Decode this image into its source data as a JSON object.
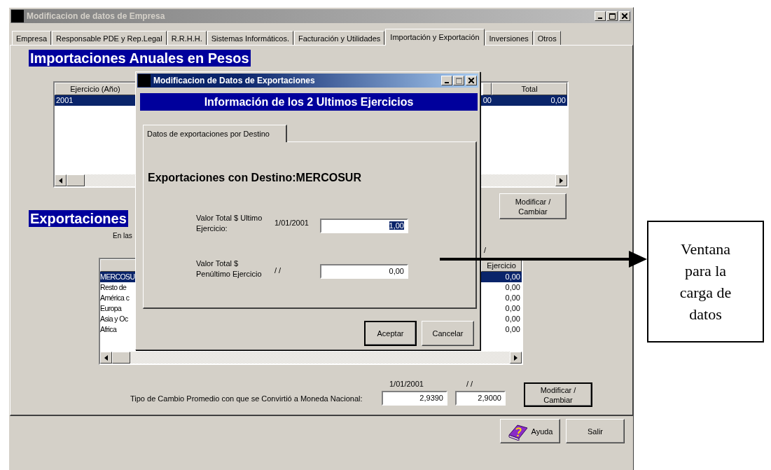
{
  "main_window": {
    "title": "Modificacion de datos de Empresa",
    "tabs": [
      {
        "label": "Empresa",
        "selected": false
      },
      {
        "label": "Responsable PDE y Rep.Legal",
        "selected": false
      },
      {
        "label": "R.R.H.H.",
        "selected": false
      },
      {
        "label": "Sistemas Informáticos.",
        "selected": false
      },
      {
        "label": "Facturación y Utilidades",
        "selected": false
      },
      {
        "label": "Importación y Exportación",
        "selected": true
      },
      {
        "label": "Inversiones",
        "selected": false
      },
      {
        "label": "Otros",
        "selected": false
      }
    ],
    "imports": {
      "heading": "Importaciones Anuales en Pesos",
      "columns": [
        "Ejercicio (Año)",
        "Total"
      ],
      "rows": [
        {
          "year": "2001",
          "column_2": "00",
          "total": "0,00",
          "selected": true
        }
      ],
      "button": "Modificar / Cambiar"
    },
    "exports": {
      "heading": "Exportaciones",
      "note": "En las",
      "date_mark": "/",
      "value_column": "Ejercicio",
      "rows": [
        {
          "name": "MERCOSU",
          "value": "0,00",
          "selected": true
        },
        {
          "name": "Resto de",
          "value": "0,00",
          "selected": false
        },
        {
          "name": "América c",
          "value": "0,00",
          "selected": false
        },
        {
          "name": "Europa",
          "value": "0,00",
          "selected": false
        },
        {
          "name": "Asia y Oc",
          "value": "0,00",
          "selected": false
        },
        {
          "name": "Africa",
          "value": "0,00",
          "selected": false
        }
      ]
    },
    "exchange": {
      "label": "Tipo de Cambio Promedio con que se Convirtió a Moneda Nacional:",
      "dates": [
        "1/01/2001",
        "/ /"
      ],
      "values": [
        "2,9390",
        "2,9000"
      ],
      "button": "Modificar / Cambiar"
    },
    "buttons": [
      {
        "kind": "help",
        "label": "Ayuda"
      },
      {
        "kind": "plain",
        "label": "Salir"
      }
    ]
  },
  "dialog": {
    "title": "Modificacion de Datos de Exportaciones",
    "banner": "Información de los 2 Ultimos Ejercicios",
    "tab": "Datos de exportaciones por Destino",
    "heading": "Exportaciones con Destino:MERCOSUR",
    "fields": [
      {
        "label": "Valor Total $ Ultimo Ejercicio:",
        "date": "1/01/2001",
        "value": "1,00",
        "highlighted": true
      },
      {
        "label": "Valor Total $ Penúltimo Ejercicio",
        "date": "/ /",
        "value": "0,00",
        "highlighted": false
      }
    ],
    "buttons": [
      "Aceptar",
      "Cancelar"
    ]
  },
  "callout": {
    "text": "Ventana para la carga de datos"
  }
}
